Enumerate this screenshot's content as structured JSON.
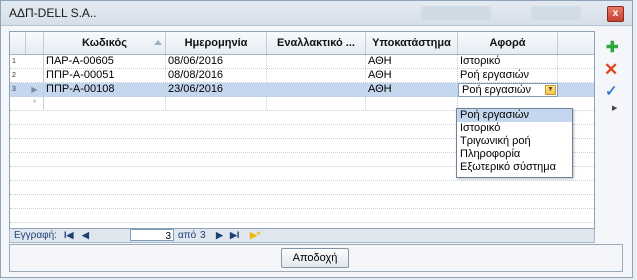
{
  "window": {
    "title": "ΑΔΠ-DELL S.A..",
    "close_label": "x"
  },
  "grid": {
    "columns": [
      "Κωδικός",
      "Ημερομηνία",
      "Εναλλακτικό ...",
      "Υποκατάστημα",
      "Αφορά"
    ],
    "rows": [
      {
        "num": "1",
        "code": "ΠΑΡ-Α-00605",
        "date": "08/06/2016",
        "alt": "",
        "branch": "ΑΘΗ",
        "about": "Ιστορικό"
      },
      {
        "num": "2",
        "code": "ΠΠΡ-Α-00051",
        "date": "08/08/2016",
        "alt": "",
        "branch": "ΑΘΗ",
        "about": "Ροή εργασιών"
      },
      {
        "num": "3",
        "code": "ΠΠΡ-Α-00108",
        "date": "23/06/2016",
        "alt": "",
        "branch": "ΑΘΗ",
        "about": "Ροή εργασιών"
      }
    ],
    "new_row_marker": "*",
    "current_row_marker": "▶",
    "editor_value": "Ροή εργασιών",
    "dropdown_options": [
      "Ροή εργασιών",
      "Ιστορικό",
      "Τριγωνική ροή",
      "Πληροφορία",
      "Εξωτερικό σύστημα"
    ],
    "dropdown_selected_index": 0
  },
  "navigator": {
    "label": "Εγγραφή:",
    "current": "3",
    "of_label": "από",
    "total": "3"
  },
  "side_tools": {
    "add_icon": "plus-icon",
    "delete_icon": "delete-icon",
    "apply_icon": "check-icon",
    "more_icon": "more-icon"
  },
  "footer": {
    "accept_label": "Αποδοχή"
  },
  "colors": {
    "selection": "#c5d7ef",
    "border": "#8ea2b8",
    "add": "#2fa83a",
    "delete": "#e04422"
  }
}
